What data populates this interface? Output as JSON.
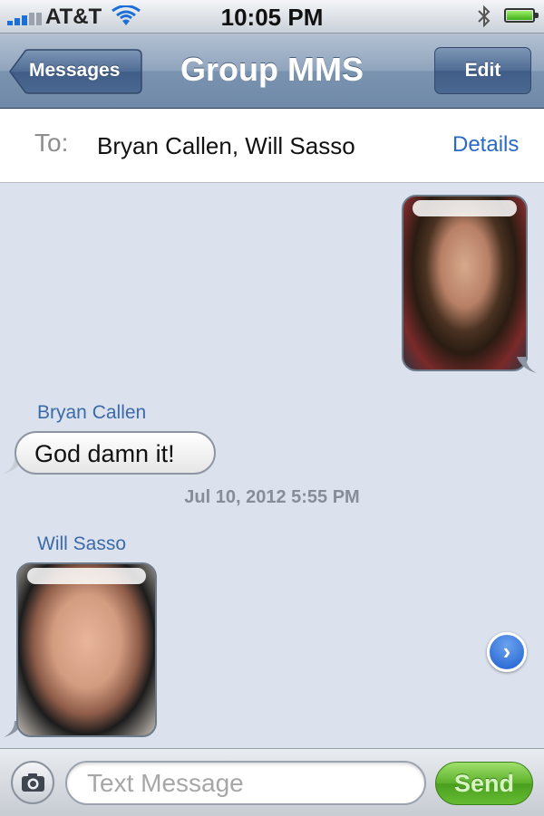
{
  "status_bar": {
    "carrier": "AT&T",
    "time": "10:05 PM",
    "battery_level": 1.0
  },
  "nav": {
    "back_label": "Messages",
    "title": "Group MMS",
    "edit_label": "Edit"
  },
  "recipients": {
    "to_label": "To:",
    "names": "Bryan Callen, Will Sasso",
    "details_label": "Details"
  },
  "messages": [
    {
      "type": "photo",
      "direction": "outgoing"
    },
    {
      "type": "text",
      "direction": "incoming",
      "sender": "Bryan Callen",
      "text": "God damn it!"
    },
    {
      "type": "timestamp",
      "text": "Jul 10, 2012 5:55 PM"
    },
    {
      "type": "photo",
      "direction": "incoming",
      "sender": "Will Sasso"
    }
  ],
  "compose": {
    "placeholder": "Text Message",
    "send_label": "Send"
  },
  "colors": {
    "nav_accent": "#7a93b0",
    "link_blue": "#2b69c8",
    "send_green": "#5cb02a",
    "background": "#dbe2ed"
  },
  "icons": [
    "signal-icon",
    "wifi-icon",
    "bluetooth-icon",
    "battery-icon",
    "camera-icon",
    "chevron-right-icon"
  ]
}
